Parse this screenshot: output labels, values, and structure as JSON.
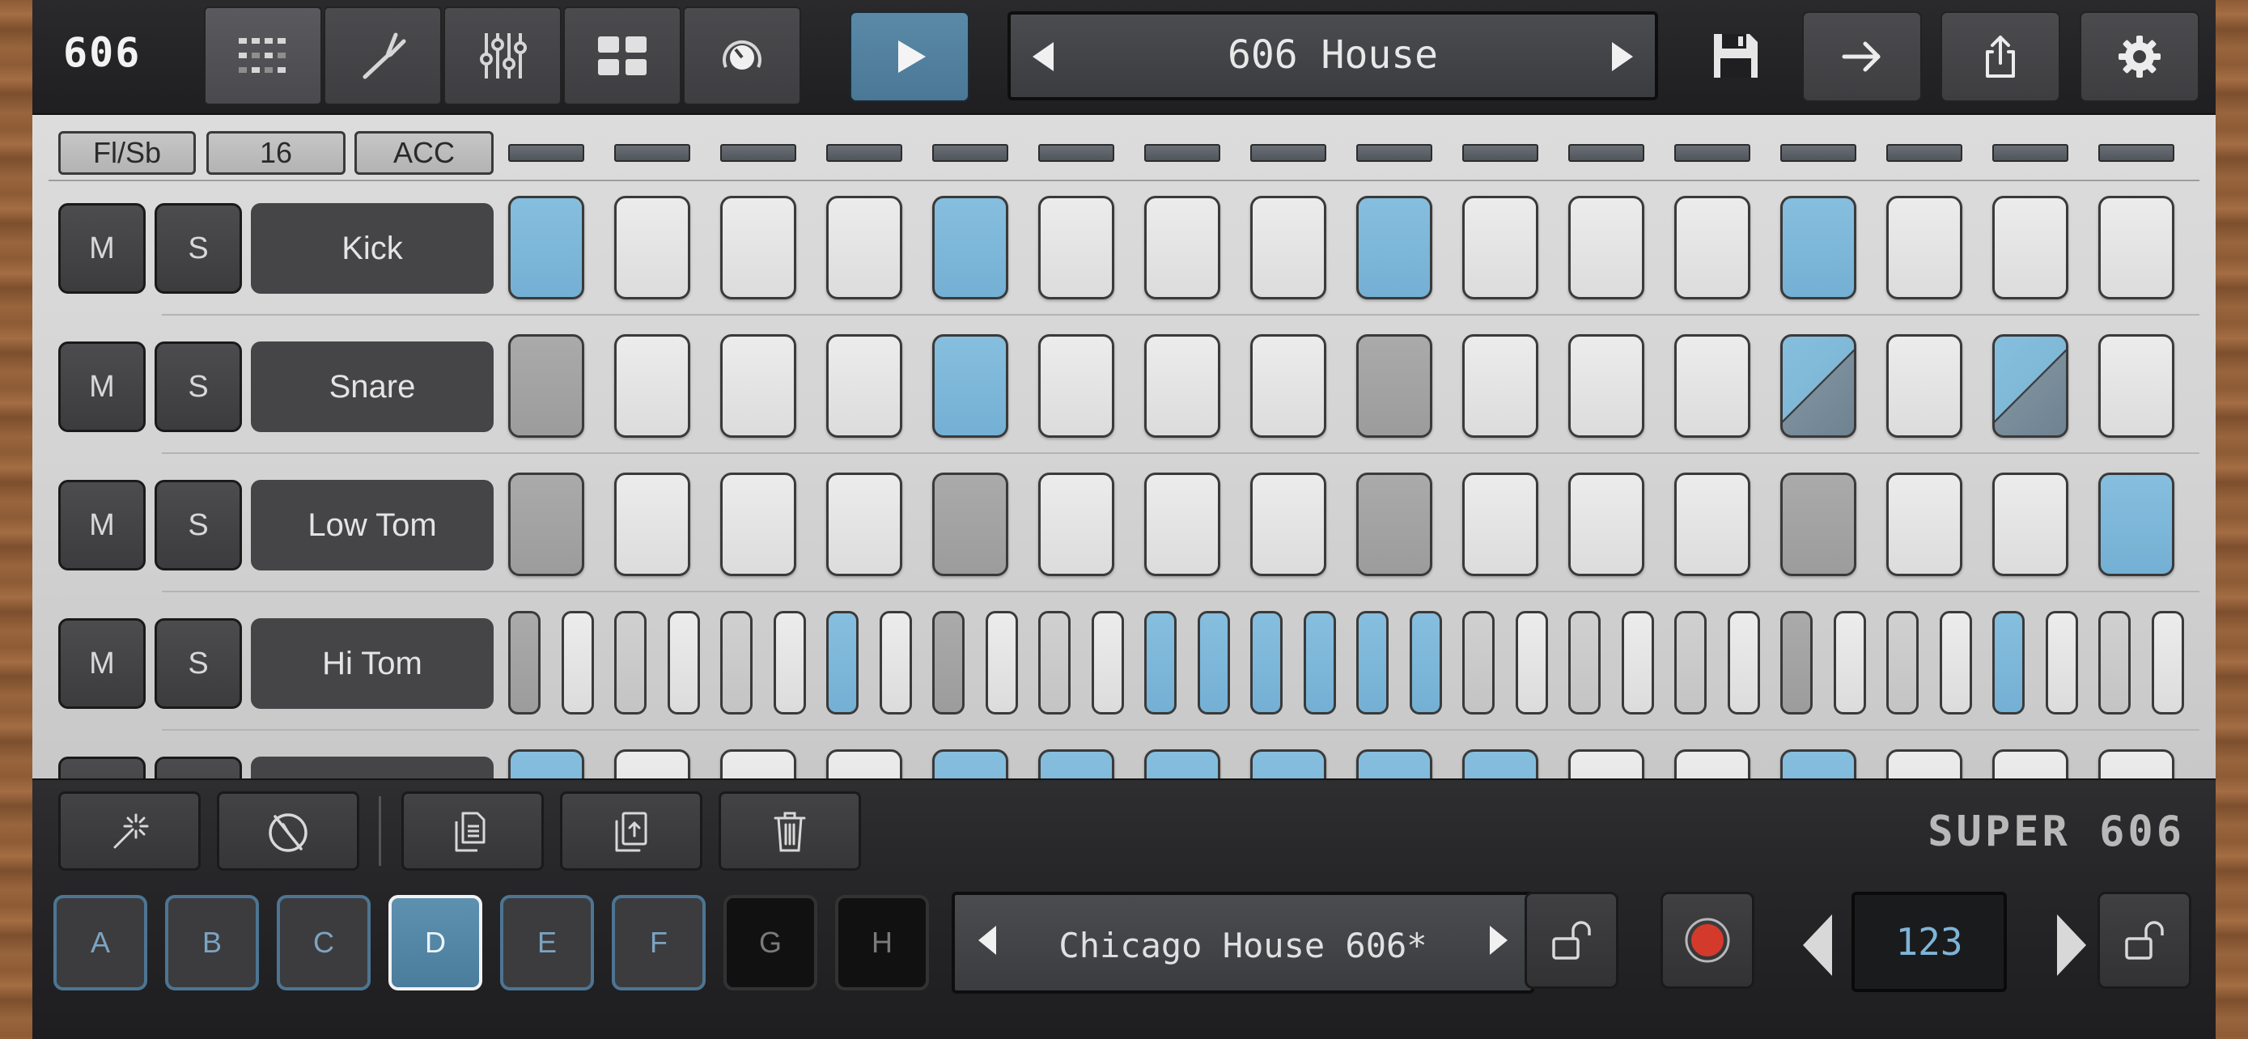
{
  "app": {
    "logo": "606",
    "brand": "SUPER 606"
  },
  "topbar": {
    "nav": [
      {
        "icon": "step-grid-icon",
        "active": true
      },
      {
        "icon": "tuning-fork-icon",
        "active": false
      },
      {
        "icon": "mixer-sliders-icon",
        "active": false
      },
      {
        "icon": "pattern-grid-icon",
        "active": false
      },
      {
        "icon": "knob-icon",
        "active": false
      }
    ],
    "play_icon": "play-icon",
    "preset_name": "606 House",
    "prev_icon": "triangle-left-icon",
    "next_icon": "triangle-right-icon",
    "save_icon": "floppy-disk-icon",
    "actions": [
      "arrow-right-icon",
      "share-icon",
      "gear-icon"
    ]
  },
  "sequencer": {
    "header": {
      "flam": "Fl/Sb",
      "steps": "16",
      "accent": "ACC"
    },
    "step_count": 16,
    "tracks": [
      {
        "mute": "M",
        "solo": "S",
        "name": "Kick",
        "steps": [
          "on",
          "off",
          "off",
          "off",
          "on",
          "off",
          "off",
          "off",
          "on",
          "off",
          "off",
          "off",
          "on",
          "off",
          "off",
          "off"
        ]
      },
      {
        "mute": "M",
        "solo": "S",
        "name": "Snare",
        "steps": [
          "acc",
          "off",
          "off",
          "off",
          "on",
          "off",
          "off",
          "off",
          "acc",
          "off",
          "off",
          "off",
          "flam",
          "off",
          "flam",
          "off"
        ]
      },
      {
        "mute": "M",
        "solo": "S",
        "name": "Low Tom",
        "steps": [
          "acc",
          "off",
          "off",
          "off",
          "acc",
          "off",
          "off",
          "off",
          "acc",
          "off",
          "off",
          "off",
          "acc",
          "off",
          "off",
          "on"
        ]
      },
      {
        "mute": "M",
        "solo": "S",
        "name": "Hi Tom",
        "substeps": [
          "acc",
          "off",
          "mid",
          "off",
          "mid",
          "off",
          "on",
          "off",
          "acc",
          "off",
          "mid",
          "off",
          "on",
          "on",
          "on",
          "on",
          "on",
          "on",
          "mid",
          "off",
          "mid",
          "off",
          "mid",
          "off",
          "acc",
          "off",
          "mid",
          "off",
          "on",
          "off",
          "mid",
          "off"
        ]
      },
      {
        "mute": "M",
        "solo": "S",
        "name": "",
        "steps": [
          "on",
          "off",
          "off",
          "off",
          "on",
          "on",
          "on",
          "on",
          "on",
          "on",
          "off",
          "off",
          "on",
          "off",
          "off",
          "off"
        ]
      }
    ]
  },
  "toolbar": {
    "tools": [
      "magic-wand-icon",
      "clear-knob-icon",
      "copy-icon",
      "paste-icon",
      "trash-icon"
    ]
  },
  "bottombar": {
    "patterns": [
      {
        "label": "A",
        "state": "normal"
      },
      {
        "label": "B",
        "state": "normal"
      },
      {
        "label": "C",
        "state": "normal"
      },
      {
        "label": "D",
        "state": "active"
      },
      {
        "label": "E",
        "state": "normal"
      },
      {
        "label": "F",
        "state": "normal"
      },
      {
        "label": "G",
        "state": "dark"
      },
      {
        "label": "H",
        "state": "dark"
      }
    ],
    "pattern_name": "Chicago House 606*",
    "tempo": "123",
    "lock_icon": "unlock-icon",
    "record_icon": "record-icon"
  },
  "colors": {
    "step_on": "#7db8dc",
    "step_off": "#e4e4e4",
    "step_accent": "#a4a4a4",
    "play_button": "#527f9e",
    "tempo_text": "#7fb4d8"
  }
}
